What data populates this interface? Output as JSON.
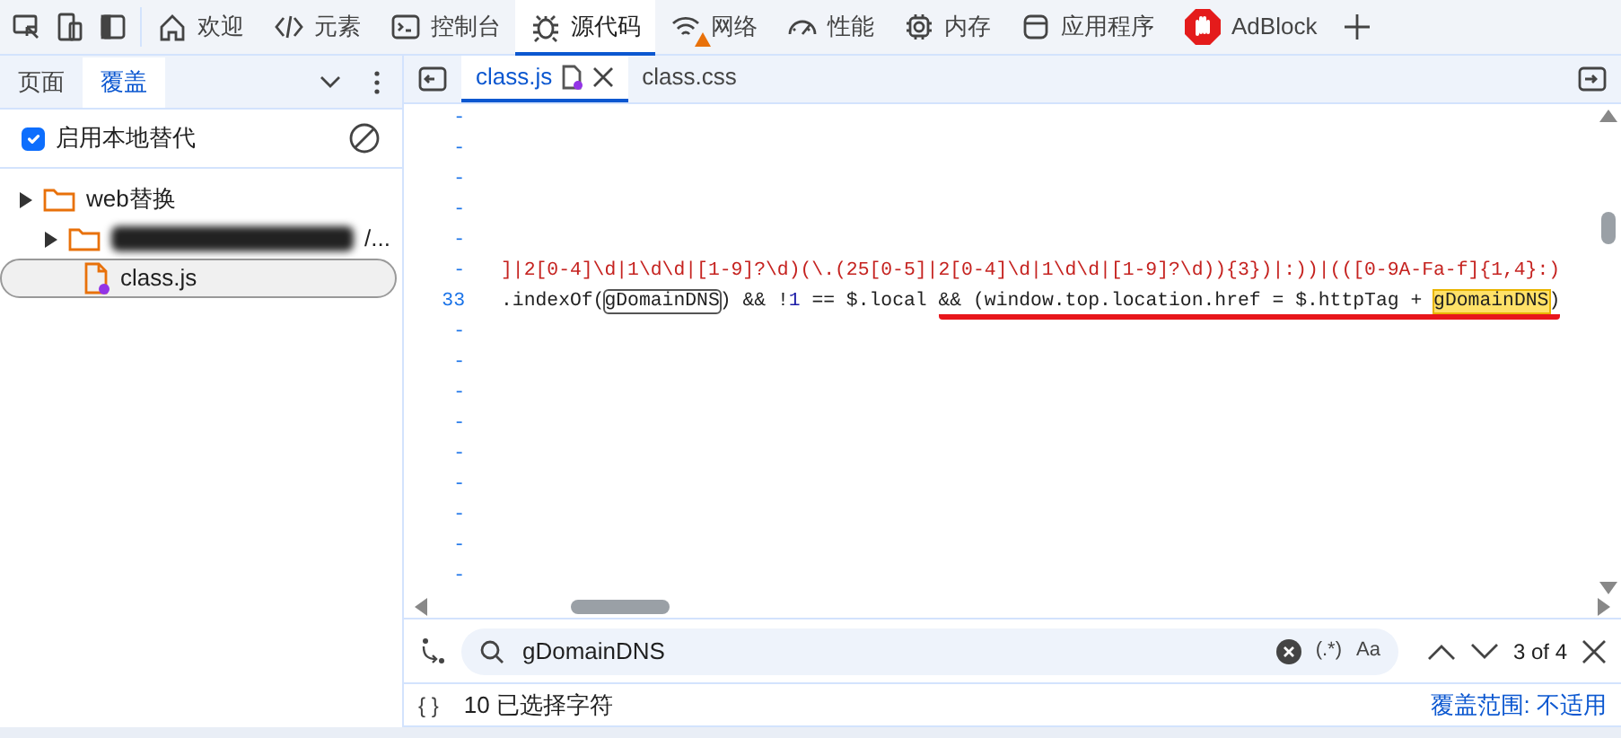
{
  "toolbar": {
    "tabs": [
      {
        "label": "欢迎",
        "selected": false,
        "warning": false
      },
      {
        "label": "元素",
        "selected": false,
        "warning": false
      },
      {
        "label": "控制台",
        "selected": false,
        "warning": false
      },
      {
        "label": "源代码",
        "selected": true,
        "warning": false
      },
      {
        "label": "网络",
        "selected": false,
        "warning": true
      },
      {
        "label": "性能",
        "selected": false,
        "warning": false
      },
      {
        "label": "内存",
        "selected": false,
        "warning": false
      },
      {
        "label": "应用程序",
        "selected": false,
        "warning": false
      },
      {
        "label": "AdBlock",
        "selected": false,
        "warning": false
      }
    ]
  },
  "sidebar": {
    "tabs": [
      {
        "label": "页面",
        "selected": false
      },
      {
        "label": "覆盖",
        "selected": true
      }
    ],
    "override": {
      "label": "启用本地替代",
      "checked": true
    },
    "tree": [
      {
        "name": "web替换",
        "kind": "folder",
        "selected": false,
        "children": [
          {
            "name": "/...",
            "kind": "folder",
            "redacted": true,
            "selected": false
          },
          {
            "name": "class.js",
            "kind": "file",
            "selected": true
          }
        ]
      }
    ]
  },
  "editor": {
    "tabs": [
      {
        "label": "class.js",
        "selected": true,
        "modified": true
      },
      {
        "label": "class.css",
        "selected": false,
        "modified": false
      }
    ],
    "lines": [
      {
        "number": "-"
      },
      {
        "number": "-"
      },
      {
        "number": "-"
      },
      {
        "number": "-"
      },
      {
        "number": "-"
      },
      {
        "number": "-",
        "segments": [
          {
            "kind": "string",
            "text": "]|2[0-4]\\d|1\\d\\d|[1-9]?\\d)(\\.(25[0-5]|2[0-4]\\d|1\\d\\d|[1-9]?\\d)){3})|:))|(([0-9A-Fa-f]{1,4}:)"
          }
        ]
      },
      {
        "number": "33",
        "segments": [
          {
            "kind": "plain",
            "text": ".indexOf("
          },
          {
            "kind": "match",
            "text": "gDomainDNS"
          },
          {
            "kind": "plain",
            "text": ") && !"
          },
          {
            "kind": "number",
            "text": "1"
          },
          {
            "kind": "plain",
            "text": " == $.local "
          },
          {
            "kind": "annotated",
            "children": [
              {
                "kind": "plain",
                "text": "&& (window.top.location.href = $.httpTag + "
              },
              {
                "kind": "current",
                "text": "gDomainDNS"
              },
              {
                "kind": "plain",
                "text": ")"
              }
            ]
          }
        ]
      },
      {
        "number": "-"
      },
      {
        "number": "-"
      },
      {
        "number": "-"
      },
      {
        "number": "-"
      },
      {
        "number": "-"
      },
      {
        "number": "-"
      },
      {
        "number": "-"
      },
      {
        "number": "-"
      },
      {
        "number": "-"
      }
    ]
  },
  "search": {
    "value": "gDomainDNS",
    "regex_toggle": "(.*)",
    "case_toggle": "Aa",
    "count": "3 of 4"
  },
  "status_bar": {
    "braces": "{ }",
    "selection": "10 已选择字符",
    "coverage": "覆盖范围: 不适用"
  }
}
